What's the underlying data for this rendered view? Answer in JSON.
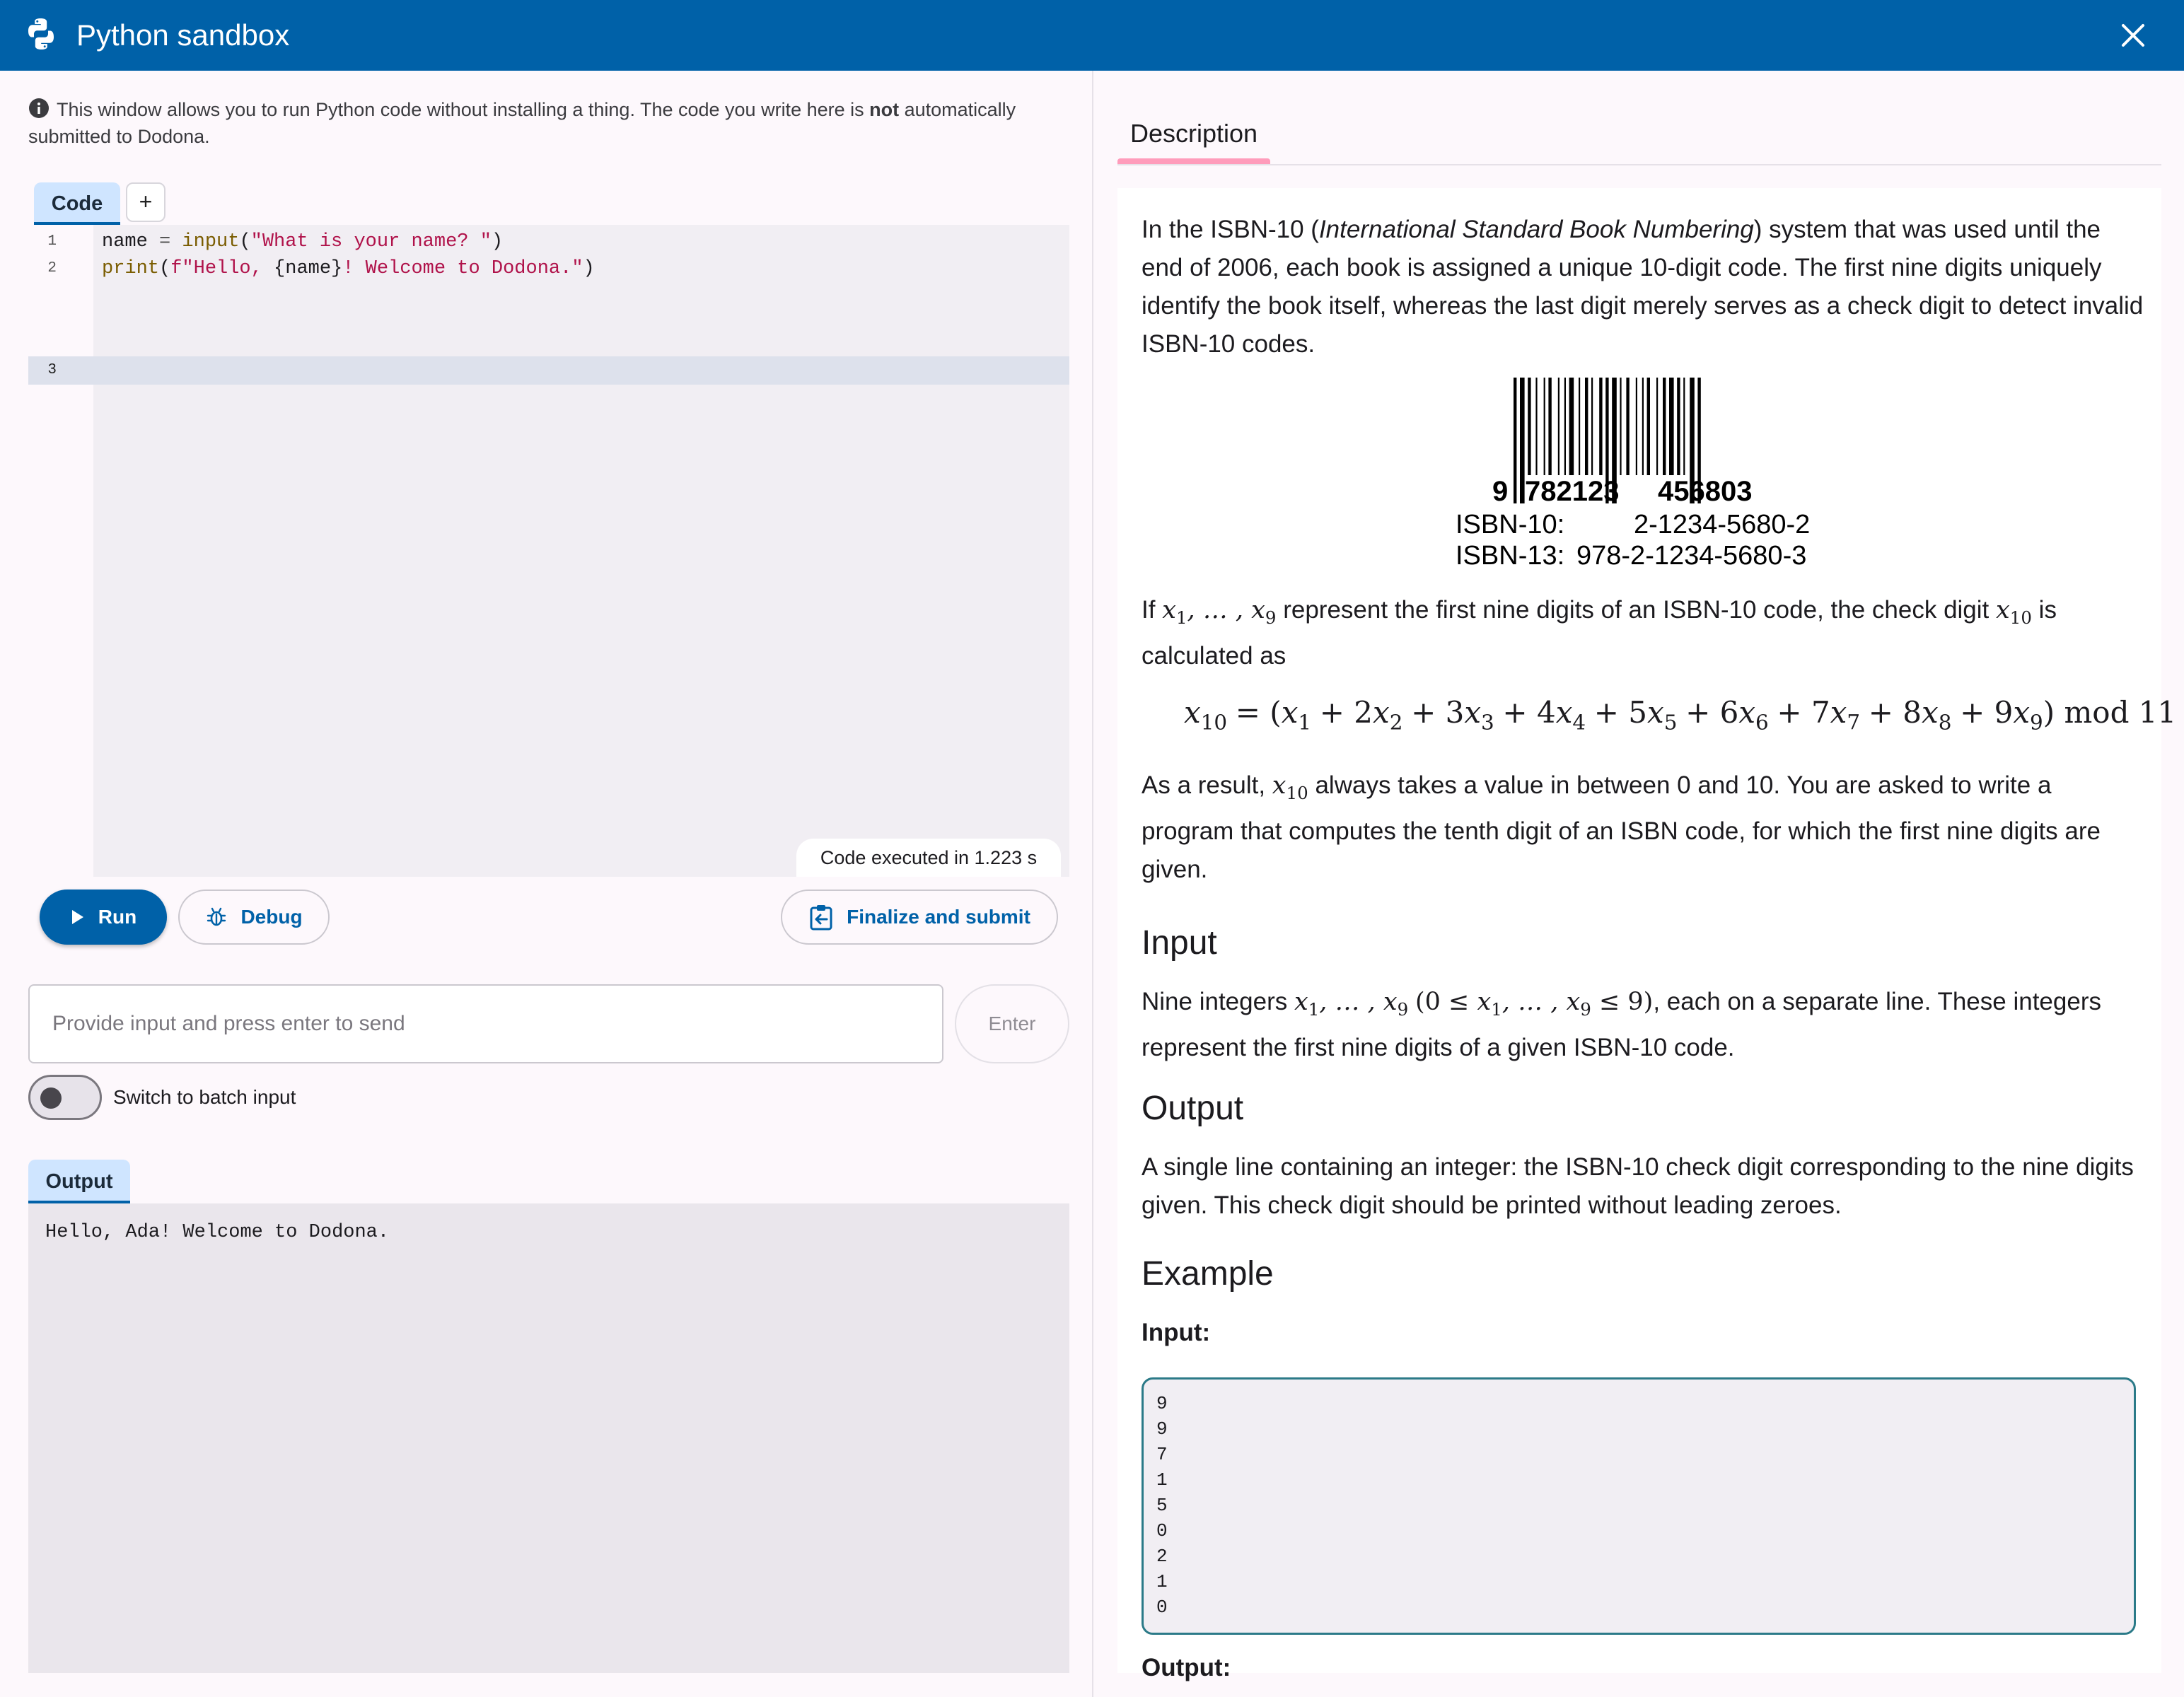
{
  "window": {
    "title": "Python sandbox"
  },
  "notice": {
    "text_before": "This window allows you to run Python code without installing a thing. The code you write here is ",
    "text_bold": "not",
    "text_after": " automatically submitted to Dodona."
  },
  "editor": {
    "tabs": [
      {
        "label": "Code"
      },
      {
        "label": "+"
      }
    ],
    "lines": [
      {
        "number": "1"
      },
      {
        "number": "2"
      },
      {
        "number": "3"
      }
    ],
    "line1": {
      "var": "name",
      "op": " = ",
      "fn": "input",
      "open": "(",
      "str": "\"What is your name? \"",
      "close": ")"
    },
    "line2": {
      "fn": "print",
      "open": "(",
      "str_a": "f\"Hello, ",
      "interp": "{name}",
      "str_b": "! Welcome to Dodona.\"",
      "close": ")"
    },
    "status": "Code executed in 1.223 s"
  },
  "actions": {
    "run_label": "Run",
    "debug_label": "Debug",
    "submit_label": "Finalize and submit"
  },
  "input": {
    "placeholder": "Provide input and press enter to send",
    "enter_label": "Enter",
    "batch_toggle_label": "Switch to batch input",
    "batch_toggle_on": false
  },
  "output": {
    "tab_label": "Output",
    "text": "Hello, Ada! Welcome to Dodona."
  },
  "description": {
    "tab_label": "Description",
    "intro_before": "In the ISBN-10 (",
    "intro_italic": "International Standard Book Numbering",
    "intro_after": ") system that was used until the end of 2006, each book is assigned a unique 10-digit code. The first nine digits uniquely identify the book itself, whereas the last digit merely serves as a check digit to detect invalid ISBN-10 codes.",
    "barcode": {
      "lead_digit": "9",
      "group1": "782123",
      "group2": "456803",
      "isbn10_label": "ISBN-10:",
      "isbn10_value": "2-1234-5680-2",
      "isbn13_label": "ISBN-13:",
      "isbn13_value": "978-2-1234-5680-3"
    },
    "check_before": "If ",
    "check_middle": " represent the first nine digits of an ISBN-10 code, the check digit ",
    "check_after": " is calculated as",
    "result_before": "As a result, ",
    "result_after": " always takes a value in between 0 and 10. You are asked to write a program that computes the tenth digit of an ISBN code, for which the first nine digits are given.",
    "input_heading": "Input",
    "input_before": "Nine integers ",
    "input_after": ", each on a separate line. These integers represent the first nine digits of a given ISBN-10 code.",
    "output_heading": "Output",
    "output_text": "A single line containing an integer: the ISBN-10 check digit corresponding to the nine digits given. This check digit should be printed without leading zeroes.",
    "example_heading": "Example",
    "example_input_label": "Input:",
    "example_input_lines": [
      "9",
      "9",
      "7",
      "1",
      "5",
      "0",
      "2",
      "1",
      "0"
    ],
    "example_output_label": "Output:"
  },
  "colors": {
    "primary": "#0061a8",
    "tab_active_bg": "#cfe5ff",
    "desc_tab_indicator": "#ff9cbb",
    "example_border": "#2b7a88",
    "code_string": "#b0124a",
    "code_builtin": "#7a5c00"
  }
}
